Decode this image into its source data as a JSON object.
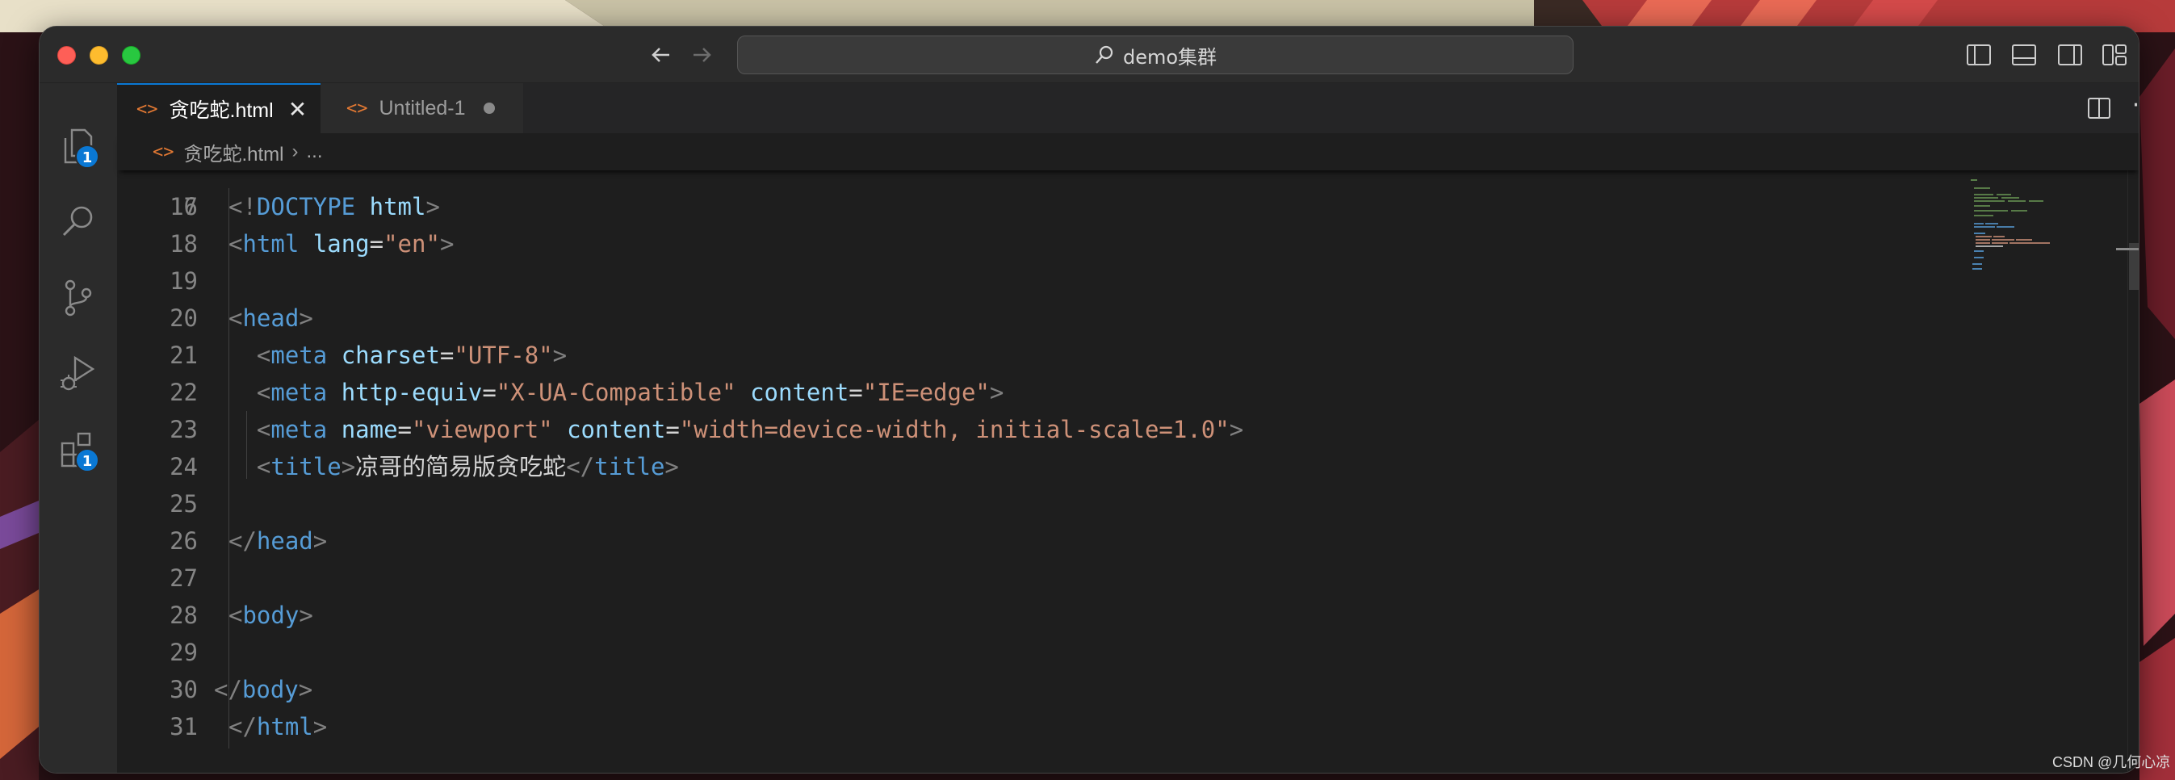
{
  "window": {
    "search_text": "demo集群"
  },
  "activity_bar": {
    "explorer_badge": "1",
    "extensions_badge": "1"
  },
  "tabs": [
    {
      "label": "贪吃蛇.html",
      "icon": "html-file-icon",
      "active": true,
      "close": "✕"
    },
    {
      "label": "Untitled-1",
      "icon": "html-file-icon",
      "active": false,
      "dirty": true
    }
  ],
  "breadcrumb": {
    "file": "贪吃蛇.html",
    "separator": "›",
    "rest": "..."
  },
  "editor": {
    "partial_top_line": "16",
    "lines": [
      {
        "n": "17",
        "parts": [
          [
            "punc",
            "<!"
          ],
          [
            "tag",
            "DOCTYPE"
          ],
          [
            "text",
            " "
          ],
          [
            "attr",
            "html"
          ],
          [
            "punc",
            ">"
          ]
        ]
      },
      {
        "n": "18",
        "parts": [
          [
            "punc",
            "<"
          ],
          [
            "tag",
            "html"
          ],
          [
            "text",
            " "
          ],
          [
            "attr",
            "lang"
          ],
          [
            "text",
            "="
          ],
          [
            "str",
            "\"en\""
          ],
          [
            "punc",
            ">"
          ]
        ]
      },
      {
        "n": "19",
        "parts": []
      },
      {
        "n": "20",
        "parts": [
          [
            "punc",
            "<"
          ],
          [
            "tag",
            "head"
          ],
          [
            "punc",
            ">"
          ]
        ]
      },
      {
        "n": "21",
        "parts": [
          [
            "text",
            "  "
          ],
          [
            "punc",
            "<"
          ],
          [
            "tag",
            "meta"
          ],
          [
            "text",
            " "
          ],
          [
            "attr",
            "charset"
          ],
          [
            "text",
            "="
          ],
          [
            "str",
            "\"UTF-8\""
          ],
          [
            "punc",
            ">"
          ]
        ]
      },
      {
        "n": "22",
        "parts": [
          [
            "text",
            "  "
          ],
          [
            "punc",
            "<"
          ],
          [
            "tag",
            "meta"
          ],
          [
            "text",
            " "
          ],
          [
            "attr",
            "http-equiv"
          ],
          [
            "text",
            "="
          ],
          [
            "str",
            "\"X-UA-Compatible\""
          ],
          [
            "text",
            " "
          ],
          [
            "attr",
            "content"
          ],
          [
            "text",
            "="
          ],
          [
            "str",
            "\"IE=edge\""
          ],
          [
            "punc",
            ">"
          ]
        ]
      },
      {
        "n": "23",
        "parts": [
          [
            "text",
            "  "
          ],
          [
            "punc",
            "<"
          ],
          [
            "tag",
            "meta"
          ],
          [
            "text",
            " "
          ],
          [
            "attr",
            "name"
          ],
          [
            "text",
            "="
          ],
          [
            "str",
            "\"viewport\""
          ],
          [
            "text",
            " "
          ],
          [
            "attr",
            "content"
          ],
          [
            "text",
            "="
          ],
          [
            "str",
            "\"width=device-width, initial-scale=1.0\""
          ],
          [
            "punc",
            ">"
          ]
        ]
      },
      {
        "n": "24",
        "parts": [
          [
            "text",
            "  "
          ],
          [
            "punc",
            "<"
          ],
          [
            "tag",
            "title"
          ],
          [
            "punc",
            ">"
          ],
          [
            "text",
            "凉哥的简易版贪吃蛇"
          ],
          [
            "punc",
            "</"
          ],
          [
            "tag",
            "title"
          ],
          [
            "punc",
            ">"
          ]
        ]
      },
      {
        "n": "25",
        "parts": []
      },
      {
        "n": "26",
        "parts": [
          [
            "punc",
            "</"
          ],
          [
            "tag",
            "head"
          ],
          [
            "punc",
            ">"
          ]
        ]
      },
      {
        "n": "27",
        "parts": []
      },
      {
        "n": "28",
        "parts": [
          [
            "punc",
            "<"
          ],
          [
            "tag",
            "body"
          ],
          [
            "punc",
            ">"
          ]
        ]
      },
      {
        "n": "29",
        "parts": []
      },
      {
        "n": "30",
        "parts": [
          [
            "punc",
            "</"
          ],
          [
            "tag",
            "body"
          ],
          [
            "punc",
            ">"
          ]
        ],
        "outdent": true
      },
      {
        "n": "31",
        "parts": [
          [
            "punc",
            "</"
          ],
          [
            "tag",
            "html"
          ],
          [
            "punc",
            ">"
          ]
        ]
      }
    ]
  },
  "watermark": "CSDN @几何心凉"
}
